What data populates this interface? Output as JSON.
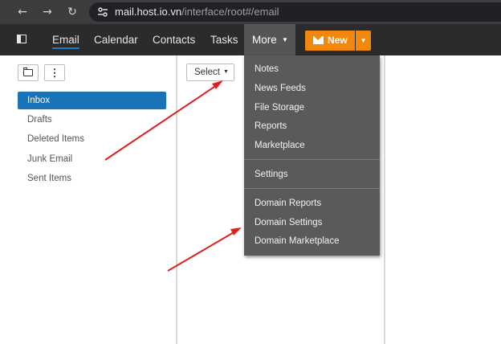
{
  "browser": {
    "back_icon": "arrow-left-icon",
    "forward_icon": "arrow-right-icon",
    "reload_icon": "reload-icon",
    "site_info_icon": "site-settings-icon",
    "url_host": "mail.host.io.vn",
    "url_path": "/interface/root#/email"
  },
  "nav": {
    "sidebar_toggle_icon": "sidebar-toggle-icon",
    "tabs": [
      "Email",
      "Calendar",
      "Contacts",
      "Tasks"
    ],
    "active_tab": "Email",
    "more_label": "More",
    "new_label": "New",
    "new_icon": "envelope-icon",
    "accent_color": "#1a7ec4",
    "new_button_color": "#f1880d"
  },
  "folders": {
    "new_folder_icon": "folder-icon",
    "options_icon": "kebab-menu-icon",
    "items": [
      "Inbox",
      "Drafts",
      "Deleted Items",
      "Junk Email",
      "Sent Items"
    ],
    "selected": "Inbox",
    "selected_color": "#1a73b6"
  },
  "message_list": {
    "select_label": "Select"
  },
  "more_menu": {
    "group1": [
      "Notes",
      "News Feeds",
      "File Storage",
      "Reports",
      "Marketplace"
    ],
    "group2": [
      "Settings"
    ],
    "group3": [
      "Domain Reports",
      "Domain Settings",
      "Domain Marketplace"
    ]
  },
  "annotation_color": "#e0201b"
}
